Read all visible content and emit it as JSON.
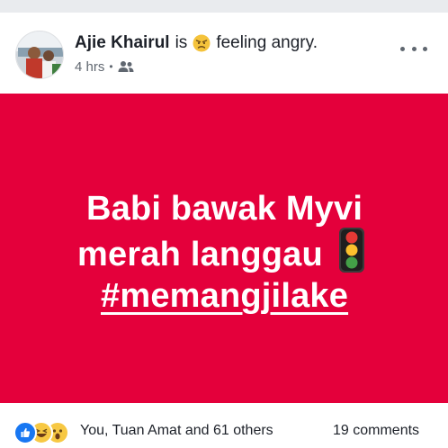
{
  "post": {
    "author": "Ajie Khairul",
    "status_prefix": "is",
    "feeling_icon": "angry-face-emoji",
    "feeling_text": "feeling angry.",
    "time": "4 hrs",
    "separator": "•",
    "audience_icon": "friends-icon",
    "more_icon": "ellipsis-icon",
    "background_color": "#e4003b",
    "text_color": "#ffffff",
    "lines": [
      "Babi bawak Myvi",
      "merah langgau"
    ],
    "line2_icon": "traffic-light-emoji",
    "hashtag": "#memangjilake"
  },
  "footer": {
    "reaction_icons": [
      "like-icon",
      "haha-icon",
      "wow-icon"
    ],
    "reaction_summary": "You, Tuan Amat and 61 others",
    "comments": "19 comments"
  }
}
